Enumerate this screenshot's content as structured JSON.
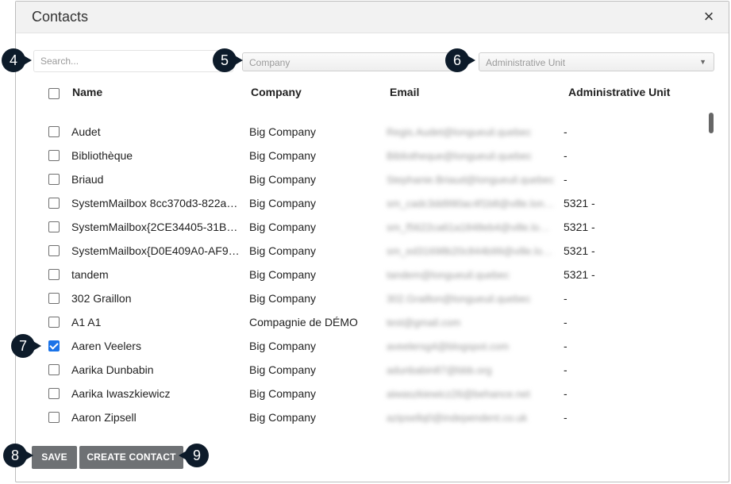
{
  "dialog": {
    "title": "Contacts",
    "close_icon": "×"
  },
  "filters": {
    "search_placeholder": "Search...",
    "company_placeholder": "Company",
    "unit_placeholder": "Administrative Unit"
  },
  "table": {
    "columns": [
      "Name",
      "Company",
      "Email",
      "Administrative Unit"
    ],
    "rows": [
      {
        "name": "Audet",
        "company": "Big Company",
        "email": "Regis.Audet@longueuil.quebec",
        "unit": "-",
        "checked": false
      },
      {
        "name": "Bibliothèque",
        "company": "Big Company",
        "email": "Bibliotheque@longueuil.quebec",
        "unit": "-",
        "checked": false
      },
      {
        "name": "Briaud",
        "company": "Big Company",
        "email": "Stephanie.Briaud@longueuil.quebec",
        "unit": "-",
        "checked": false
      },
      {
        "name": "SystemMailbox 8cc370d3-822a-…",
        "company": "Big Company",
        "email": "sm_cadc3dd990ac4f1b8@ville.longueuil.qc.ca",
        "unit": "5321 -",
        "checked": false
      },
      {
        "name": "SystemMailbox{2CE34405-31BE…",
        "company": "Big Company",
        "email": "sm_f5622ca61a1848eb4@ville.longueuil.qc.ca",
        "unit": "5321 -",
        "checked": false
      },
      {
        "name": "SystemMailbox{D0E409A0-AF9B…",
        "company": "Big Company",
        "email": "sm_ed31698b20c844b99@ville.longueuil.qc.ca",
        "unit": "5321 -",
        "checked": false
      },
      {
        "name": "tandem",
        "company": "Big Company",
        "email": "tandem@longueuil.quebec",
        "unit": "5321 -",
        "checked": false
      },
      {
        "name": "302 Graillon",
        "company": "Big Company",
        "email": "302.Graillon@longueuil.quebec",
        "unit": "-",
        "checked": false
      },
      {
        "name": "A1 A1",
        "company": "Compagnie de DÉMO",
        "email": "test@gmail.com",
        "unit": "-",
        "checked": false
      },
      {
        "name": "Aaren Veelers",
        "company": "Big Company",
        "email": "aveelersg4@blogspot.com",
        "unit": "-",
        "checked": true
      },
      {
        "name": "Aarika Dunbabin",
        "company": "Big Company",
        "email": "adunbabin87@bbb.org",
        "unit": "-",
        "checked": false
      },
      {
        "name": "Aarika Iwaszkiewicz",
        "company": "Big Company",
        "email": "aiwaszkiewicz26@behance.net",
        "unit": "-",
        "checked": false
      },
      {
        "name": "Aaron Zipsell",
        "company": "Big Company",
        "email": "azipsellq0@independent.co.uk",
        "unit": "-",
        "checked": false
      }
    ]
  },
  "footer": {
    "save_label": "SAVE",
    "create_label": "CREATE CONTACT"
  },
  "callouts": [
    "4",
    "5",
    "6",
    "7",
    "8",
    "9"
  ],
  "colors": {
    "header_bg": "#f2f2f2",
    "button_bg": "#6e7174",
    "checkbox_checked": "#1a73e8",
    "callout_bg": "#0d1b2a"
  }
}
